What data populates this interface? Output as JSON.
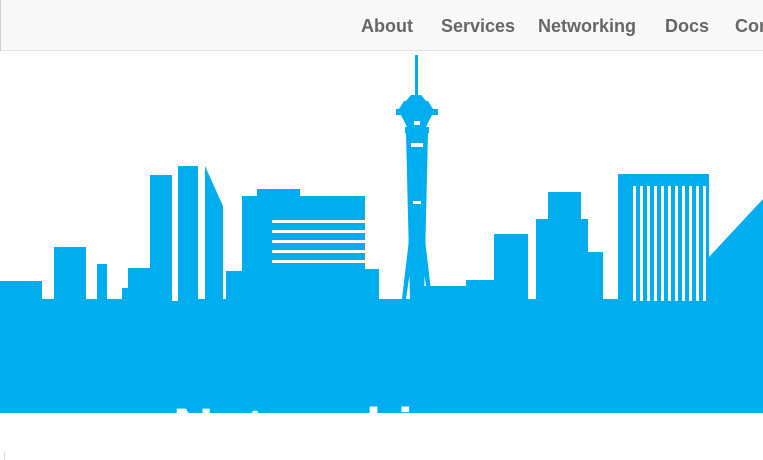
{
  "nav": {
    "items": [
      {
        "label": "About"
      },
      {
        "label": "Services"
      },
      {
        "label": "Networking"
      },
      {
        "label": "Docs"
      },
      {
        "label": "Contact"
      }
    ]
  },
  "hero": {
    "title": "Networking",
    "skyline_color": "#00aeef",
    "background_color": "#ffffff"
  },
  "colors": {
    "nav_text": "#666666",
    "topbar_bg": "#f8f8f8"
  }
}
